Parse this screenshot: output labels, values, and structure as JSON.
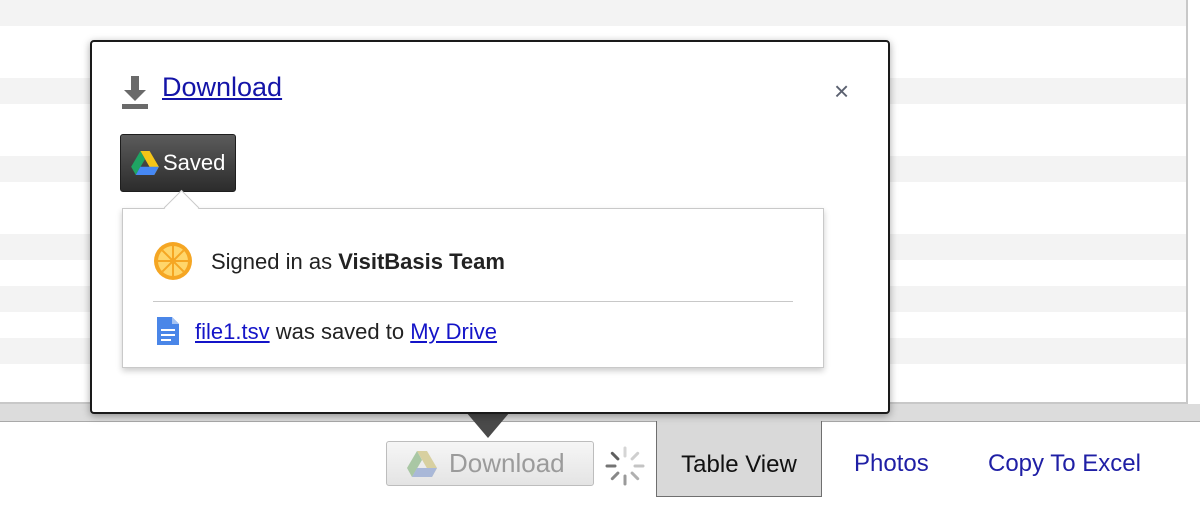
{
  "popup": {
    "download_label": "Download",
    "close_label": "×",
    "saved_button_label": "Saved",
    "signed_in_prefix": "Signed in as ",
    "signed_in_user": "VisitBasis Team",
    "file_name": "file1.tsv",
    "saved_text": " was saved to ",
    "destination": "My Drive"
  },
  "toolbar": {
    "drive_download_label": "Download",
    "tabs": [
      {
        "label": "Table View"
      },
      {
        "label": "Photos"
      },
      {
        "label": "Copy To Excel"
      }
    ]
  },
  "icons": {
    "download": "download-arrow-icon",
    "drive": "google-drive-icon",
    "user": "orange-slice-icon",
    "document": "document-icon",
    "loading": "spinner-icon"
  },
  "colors": {
    "link": "#1414a8",
    "saved_button_bg": "#3a3a3a",
    "active_tab_bg": "#d9d9d9"
  }
}
